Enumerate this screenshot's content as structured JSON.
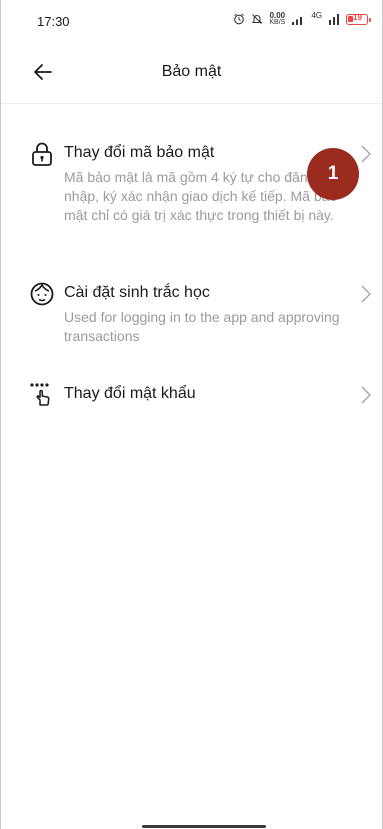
{
  "status": {
    "time": "17:30",
    "speed_value": "0.00",
    "speed_unit": "KB/S",
    "network_label": "4G",
    "battery_level": "19"
  },
  "header": {
    "title": "Bảo mật"
  },
  "items": [
    {
      "title": "Thay đổi mã bảo mật",
      "description": "Mã bảo mật là mã gồm 4 ký tự cho đăng nhập, ký xác nhận giao dịch kế tiếp. Mã bảo mật chỉ có giá trị xác thực trong thiết bị này.",
      "icon": "lock-icon"
    },
    {
      "title": "Cài đặt sinh trắc học",
      "description": "Used for logging in to the app and approving transactions",
      "icon": "face-icon"
    },
    {
      "title": "Thay đổi mật khẩu",
      "icon": "password-touch-icon"
    }
  ],
  "annotation": {
    "badge_number": "1",
    "badge_color": "#9b2a1f"
  }
}
